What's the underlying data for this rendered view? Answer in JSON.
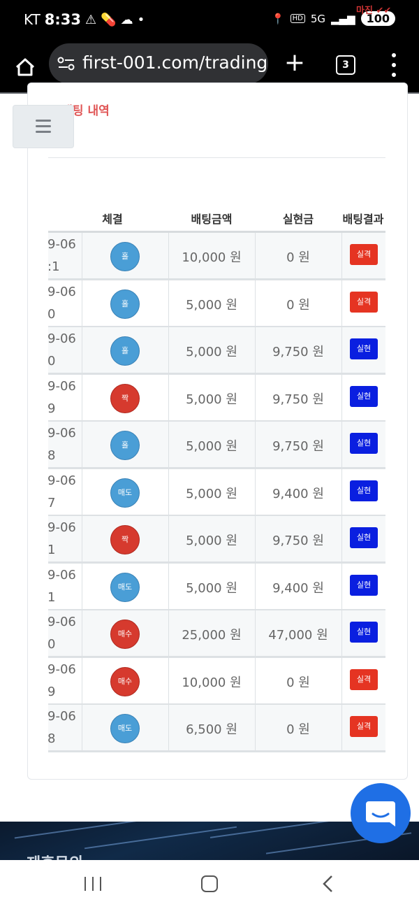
{
  "status_bar": {
    "carrier": "KT",
    "time": "8:33",
    "network": "5G",
    "battery": "100",
    "hd_badge": "HD",
    "watermark": "마진 ✔✔"
  },
  "browser": {
    "url": "first-001.com/trading",
    "tab_count": "3"
  },
  "page": {
    "section_title": "배팅 내역",
    "table": {
      "headers": [
        "체결",
        "배팅금액",
        "실현금",
        "배팅결과"
      ],
      "rows": [
        {
          "date_line1": "9-06",
          "date_line2": ":1",
          "execution": "홀",
          "execution_color": "blue",
          "bet_amount": "10,000 원",
          "realized": "0 원",
          "result": "실격",
          "result_type": "lose"
        },
        {
          "date_line1": "9-06",
          "date_line2": "0",
          "execution": "홀",
          "execution_color": "blue",
          "bet_amount": "5,000 원",
          "realized": "0 원",
          "result": "실격",
          "result_type": "lose"
        },
        {
          "date_line1": "9-06",
          "date_line2": "0",
          "execution": "홀",
          "execution_color": "blue",
          "bet_amount": "5,000 원",
          "realized": "9,750 원",
          "result": "실현",
          "result_type": "win"
        },
        {
          "date_line1": "9-06",
          "date_line2": "9",
          "execution": "짝",
          "execution_color": "red",
          "bet_amount": "5,000 원",
          "realized": "9,750 원",
          "result": "실현",
          "result_type": "win"
        },
        {
          "date_line1": "9-06",
          "date_line2": "8",
          "execution": "홀",
          "execution_color": "blue",
          "bet_amount": "5,000 원",
          "realized": "9,750 원",
          "result": "실현",
          "result_type": "win"
        },
        {
          "date_line1": "9-06",
          "date_line2": "7",
          "execution": "매도",
          "execution_color": "blue",
          "bet_amount": "5,000 원",
          "realized": "9,400 원",
          "result": "실현",
          "result_type": "win"
        },
        {
          "date_line1": "9-06",
          "date_line2": "1",
          "execution": "짝",
          "execution_color": "red",
          "bet_amount": "5,000 원",
          "realized": "9,750 원",
          "result": "실현",
          "result_type": "win"
        },
        {
          "date_line1": "9-06",
          "date_line2": "1",
          "execution": "매도",
          "execution_color": "blue",
          "bet_amount": "5,000 원",
          "realized": "9,400 원",
          "result": "실현",
          "result_type": "win"
        },
        {
          "date_line1": "9-06",
          "date_line2": "0",
          "execution": "매수",
          "execution_color": "red",
          "bet_amount": "25,000 원",
          "realized": "47,000 원",
          "result": "실현",
          "result_type": "win"
        },
        {
          "date_line1": "9-06",
          "date_line2": "9",
          "execution": "매수",
          "execution_color": "red",
          "bet_amount": "10,000 원",
          "realized": "0 원",
          "result": "실격",
          "result_type": "lose"
        },
        {
          "date_line1": "9-06",
          "date_line2": "8",
          "execution": "매도",
          "execution_color": "blue",
          "bet_amount": "6,500 원",
          "realized": "0 원",
          "result": "실격",
          "result_type": "lose"
        }
      ]
    }
  },
  "footer": {
    "text": "제휴문의"
  },
  "colors": {
    "accent_red": "#e05555",
    "result_lose": "#e53422",
    "result_win": "#0a1fe0",
    "circle_blue": "#4a9ed6",
    "circle_red": "#d63a2e",
    "chat_blue": "#1f6fe5"
  }
}
